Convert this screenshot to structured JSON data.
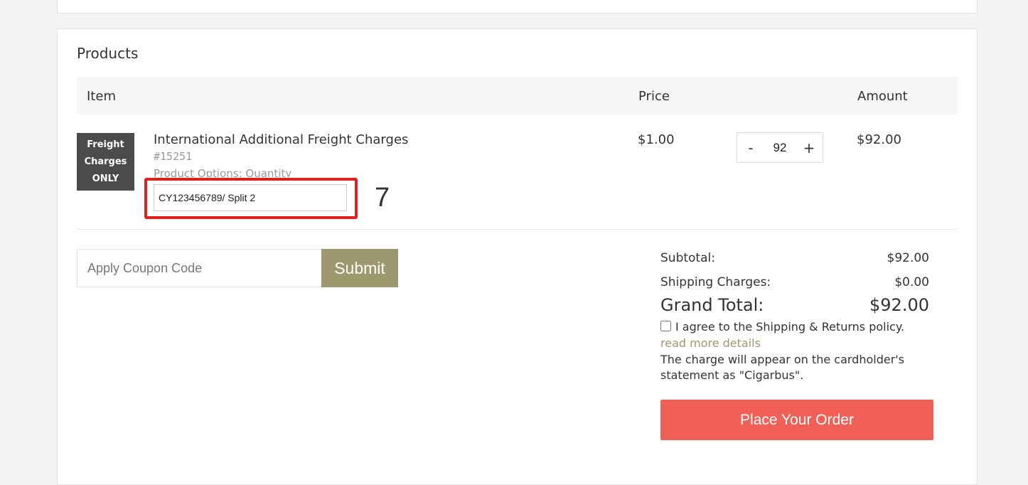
{
  "products": {
    "title": "Products",
    "columns": {
      "item": "Item",
      "price": "Price",
      "amount": "Amount"
    },
    "rows": [
      {
        "image_text": [
          "Freight",
          "Charges",
          "ONLY"
        ],
        "name": "International Additional Freight Charges",
        "sku": "#15251",
        "options_label": "Product Options: Quantity",
        "options_value": "CY123456789/ Split 2",
        "price": "$1.00",
        "quantity": "92",
        "qty_minus": "-",
        "qty_plus": "+",
        "amount": "$92.00"
      }
    ]
  },
  "annotation": {
    "number": "7",
    "color": "#e02020"
  },
  "coupon": {
    "placeholder": "Apply Coupon Code",
    "submit_label": "Submit",
    "button_color": "#9e986f"
  },
  "summary": {
    "subtotal_label": "Subtotal:",
    "subtotal_value": "$92.00",
    "shipping_label": "Shipping Charges:",
    "shipping_value": "$0.00",
    "grand_label": "Grand Total:",
    "grand_value": "$92.00",
    "agree_text": "I agree to the Shipping & Returns policy.",
    "read_more": "read more details",
    "charge_note": "The charge will appear on the cardholder's statement as \"Cigarbus\".",
    "order_button": "Place Your Order",
    "order_button_color": "#f06057"
  }
}
